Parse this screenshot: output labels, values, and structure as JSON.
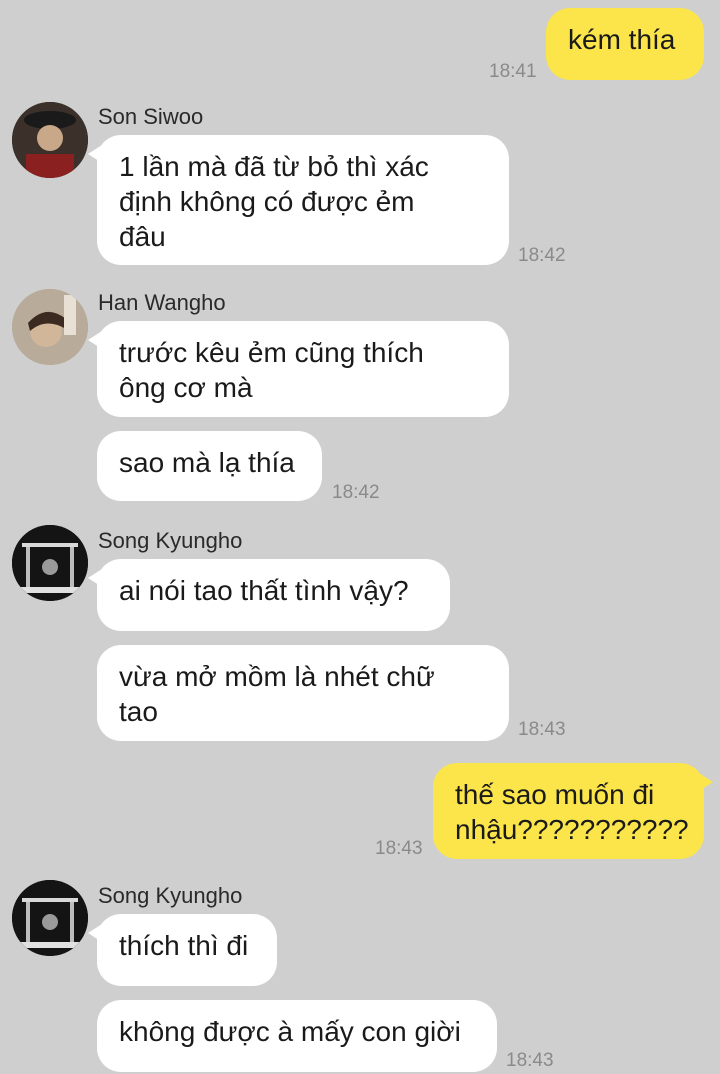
{
  "messages": [
    {
      "type": "out",
      "text": "kém thía",
      "time": "18:41"
    },
    {
      "type": "in",
      "sender": "Son Siwoo",
      "avatar": "avatar-son-siwoo",
      "text": "1 lần mà đã từ bỏ thì xác\nđịnh không có được ẻm\nđâu",
      "time": "18:42"
    },
    {
      "type": "in",
      "sender": "Han Wangho",
      "avatar": "avatar-han-wangho",
      "text": "trước kêu ẻm cũng thích\nông cơ mà"
    },
    {
      "type": "in",
      "text": "sao mà lạ thía",
      "time": "18:42"
    },
    {
      "type": "in",
      "sender": "Song Kyungho",
      "avatar": "avatar-song-kyungho",
      "text": "ai nói tao thất tình vậy?"
    },
    {
      "type": "in",
      "text": "vừa mở mồm là nhét chữ\ntao",
      "time": "18:43"
    },
    {
      "type": "out",
      "text": "thế sao muốn đi\nnhậu???????????",
      "time": "18:43"
    },
    {
      "type": "in",
      "sender": "Song Kyungho",
      "avatar": "avatar-song-kyungho",
      "text": "thích thì đi"
    },
    {
      "type": "in",
      "text": "không được à mấy con giời",
      "time": "18:43"
    }
  ]
}
